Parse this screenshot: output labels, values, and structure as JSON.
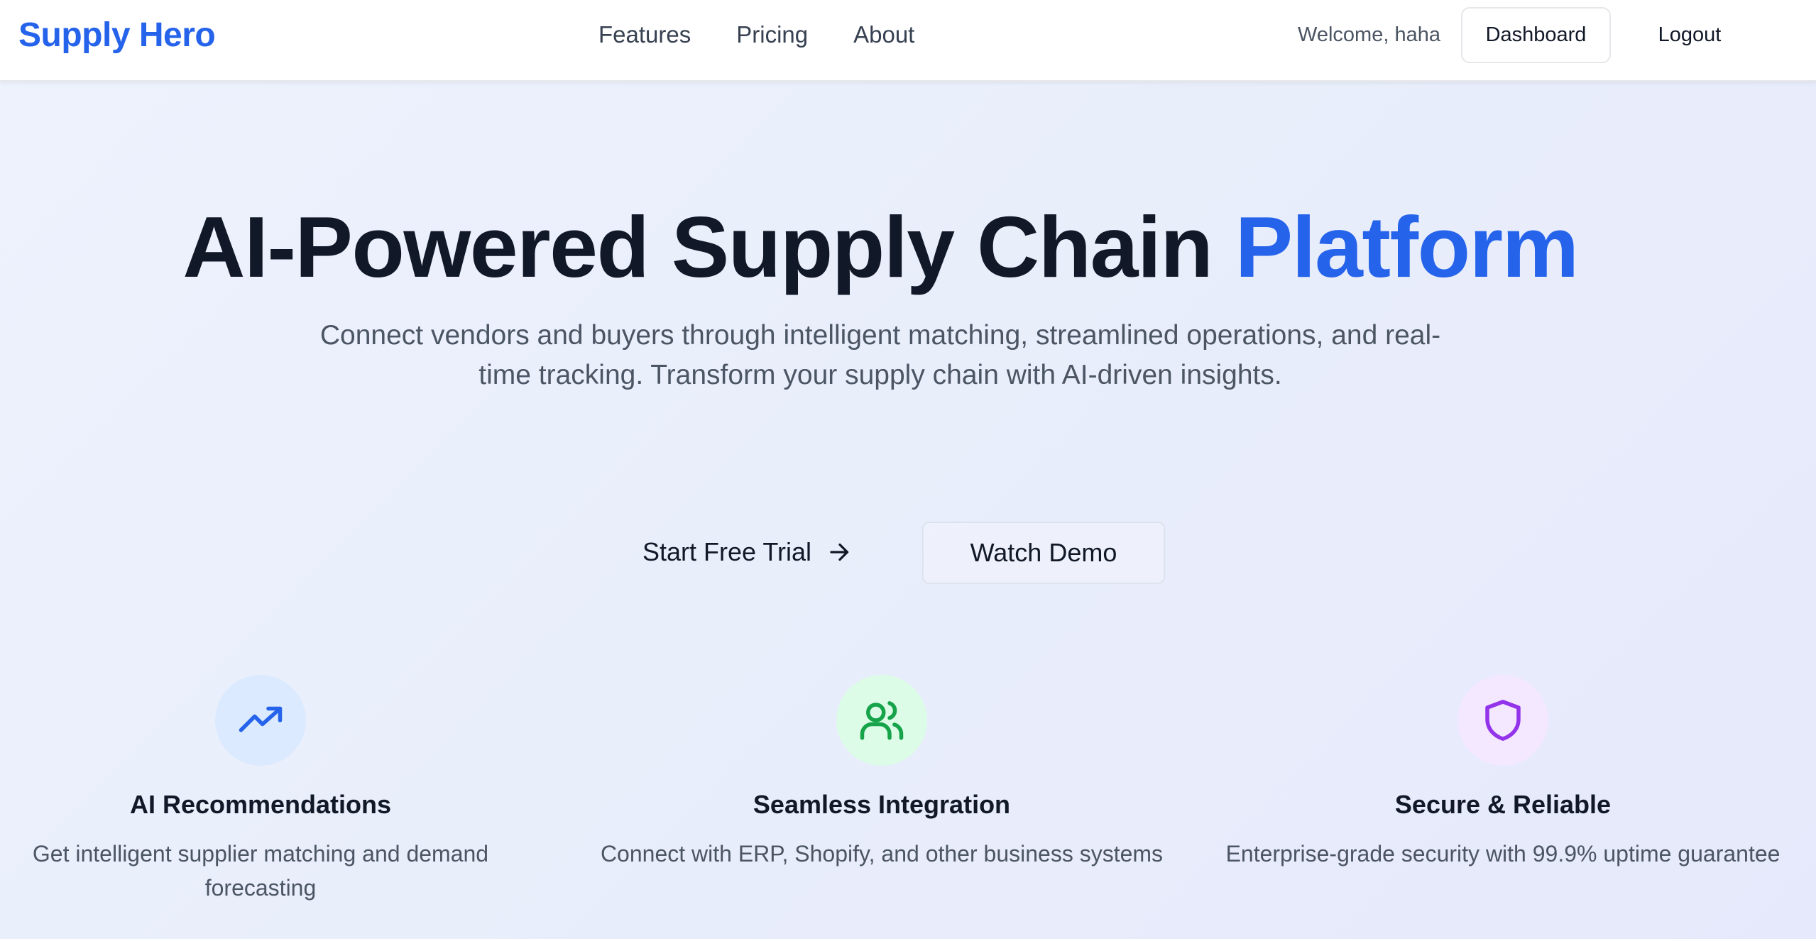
{
  "header": {
    "brand": "Supply Hero",
    "nav": [
      "Features",
      "Pricing",
      "About"
    ],
    "welcome": "Welcome, haha",
    "dashboard_label": "Dashboard",
    "logout_label": "Logout"
  },
  "hero": {
    "headline_main": "AI-Powered Supply Chain ",
    "headline_accent": "Platform",
    "subtitle": "Connect vendors and buyers through intelligent matching, streamlined operations, and real-time tracking. Transform your supply chain with AI-driven insights.",
    "cta_primary": "Start Free Trial",
    "cta_secondary": "Watch Demo"
  },
  "features": [
    {
      "icon": "trending-up-icon",
      "title": "AI Recommendations",
      "description": "Get intelligent supplier matching and demand forecasting",
      "color": "#2563eb",
      "bg": "#dbeafe"
    },
    {
      "icon": "users-icon",
      "title": "Seamless Integration",
      "description": "Connect with ERP, Shopify, and other business systems",
      "color": "#16a34a",
      "bg": "#dcfce7"
    },
    {
      "icon": "shield-icon",
      "title": "Secure & Reliable",
      "description": "Enterprise-grade security with 99.9% uptime guarantee",
      "color": "#9333ea",
      "bg": "#f3e8ff"
    }
  ],
  "colors": {
    "brand": "#2563eb",
    "text_dark": "#111827",
    "text_muted": "#4b5563",
    "hero_bg": "#eaeffc"
  }
}
